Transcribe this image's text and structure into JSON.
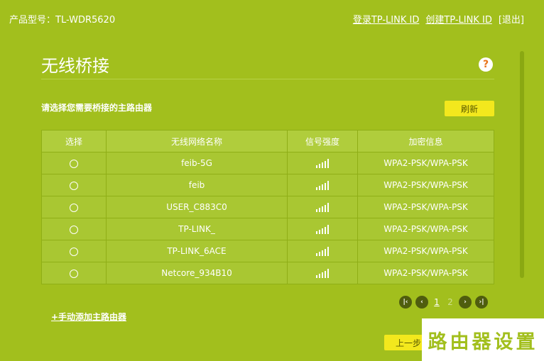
{
  "header": {
    "model": "产品型号：TL-WDR5620",
    "login_link": "登录TP-LINK ID",
    "create_link": "创建TP-LINK ID",
    "logout": "[退出]"
  },
  "page": {
    "title": "无线桥接",
    "help": "?",
    "instruction": "请选择您需要桥接的主路由器",
    "refresh": "刷新"
  },
  "table": {
    "columns": [
      "选择",
      "无线网络名称",
      "信号强度",
      "加密信息"
    ],
    "rows": [
      {
        "name": "feib-5G",
        "encryption": "WPA2-PSK/WPA-PSK",
        "signal_level": 5
      },
      {
        "name": "feib",
        "encryption": "WPA2-PSK/WPA-PSK",
        "signal_level": 5
      },
      {
        "name": "USER_C883C0",
        "encryption": "WPA2-PSK/WPA-PSK",
        "signal_level": 5
      },
      {
        "name": "TP-LINK_",
        "encryption": "WPA2-PSK/WPA-PSK",
        "signal_level": 5
      },
      {
        "name": "TP-LINK_6ACE",
        "encryption": "WPA2-PSK/WPA-PSK",
        "signal_level": 5
      },
      {
        "name": "Netcore_934B10",
        "encryption": "WPA2-PSK/WPA-PSK",
        "signal_level": 5
      }
    ]
  },
  "pager": {
    "pages": [
      "1",
      "2"
    ],
    "current": "1"
  },
  "footer": {
    "add_router": "+手动添加主路由器",
    "prev": "上一步",
    "watermark": "路由器设置"
  },
  "colors": {
    "background": "#a2bf1d",
    "button": "#f3e81d",
    "help_icon": "#e8731a"
  }
}
